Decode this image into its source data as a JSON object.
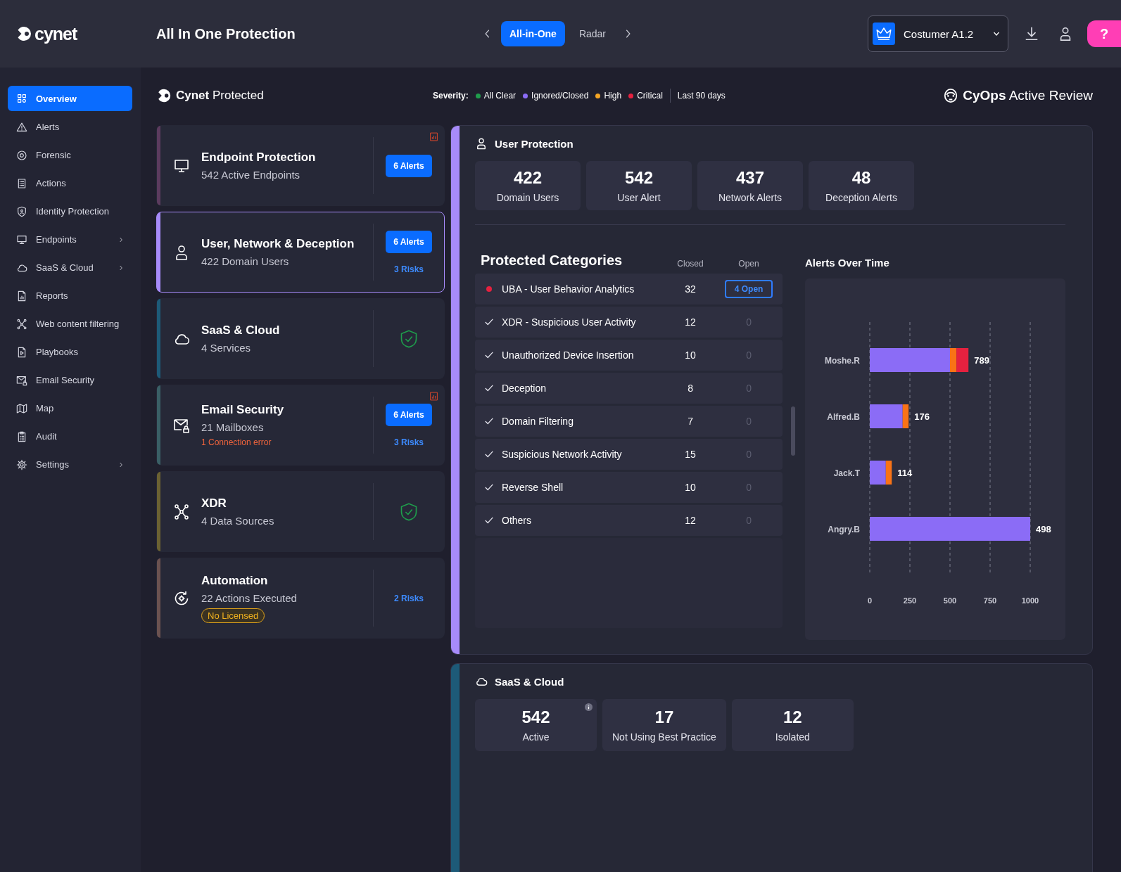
{
  "top_bar": {
    "brand": "cynet",
    "title": "All In One Protection",
    "tabs": [
      {
        "label": "All-in-One",
        "selected": true
      },
      {
        "label": "Radar",
        "selected": false
      }
    ],
    "customer": {
      "value": "Costumer A1.2"
    },
    "help": "?"
  },
  "sidebar": {
    "items": [
      {
        "label": "Overview",
        "selected": true,
        "has_submenu": false
      },
      {
        "label": "Alerts",
        "selected": false,
        "has_submenu": false
      },
      {
        "label": "Forensic",
        "selected": false,
        "has_submenu": false
      },
      {
        "label": "Actions",
        "selected": false,
        "has_submenu": false
      },
      {
        "label": "Identity Protection",
        "selected": false,
        "has_submenu": false
      },
      {
        "label": "Endpoints",
        "selected": false,
        "has_submenu": true
      },
      {
        "label": "SaaS & Cloud",
        "selected": false,
        "has_submenu": true
      },
      {
        "label": "Reports",
        "selected": false,
        "has_submenu": false
      },
      {
        "label": "Web content filtering",
        "selected": false,
        "has_submenu": false
      },
      {
        "label": "Playbooks",
        "selected": false,
        "has_submenu": false
      },
      {
        "label": "Email Security",
        "selected": false,
        "has_submenu": false
      },
      {
        "label": "Map",
        "selected": false,
        "has_submenu": false
      },
      {
        "label": "Audit",
        "selected": false,
        "has_submenu": false
      },
      {
        "label": "Settings",
        "selected": false,
        "has_submenu": true
      }
    ]
  },
  "header": {
    "title": "**Cynet** Protected",
    "severity_label": "Severity:",
    "severity": [
      {
        "label": "All Clear",
        "color": "#1f9d4c"
      },
      {
        "label": "Ignored/Closed",
        "color": "#8b6cf6"
      },
      {
        "label": "High",
        "color": "#f5a524"
      },
      {
        "label": "Critical",
        "color": "#e5213f"
      }
    ],
    "period": "Last 90 days",
    "review": "**CyOps** Active Review"
  },
  "cards": [
    {
      "title": "Endpoint Protection",
      "subtitle": "542 Active Endpoints",
      "alerts": "6 Alerts",
      "chart_icon": true,
      "protected": false,
      "selected": false,
      "color": "#5b3b5e"
    },
    {
      "title": "User, Network & Deception",
      "subtitle": "422 Domain Users",
      "alerts": "6 Alerts",
      "risks": "3 Risks",
      "chart_icon": false,
      "protected": false,
      "selected": true,
      "color": "#a78bfa"
    },
    {
      "title": "SaaS & Cloud",
      "subtitle": "4 Services",
      "chart_icon": false,
      "protected": true,
      "selected": false,
      "color": "#1d5a78"
    },
    {
      "title": "Email Security",
      "subtitle": "21 Mailboxes",
      "error": "1 Connection error",
      "alerts": "6 Alerts",
      "risks": "3 Risks",
      "chart_icon": true,
      "protected": false,
      "selected": false,
      "color": "#3a5f66"
    },
    {
      "title": "XDR",
      "subtitle": "4 Data Sources",
      "chart_icon": false,
      "protected": true,
      "selected": false,
      "color": "#6b6132"
    },
    {
      "title": "Automation",
      "subtitle": "22 Actions Executed",
      "badge": "No Licensed",
      "risks": "2 Risks",
      "chart_icon": false,
      "protected": false,
      "selected": false,
      "color": "#6b5250"
    }
  ],
  "user_protection": {
    "title": "User Protection",
    "color": "#a78bfa",
    "stats": [
      {
        "value": "422",
        "label": "Domain Users"
      },
      {
        "value": "542",
        "label": "User Alert"
      },
      {
        "value": "437",
        "label": "Network Alerts"
      },
      {
        "value": "48",
        "label": "Deception Alerts"
      }
    ],
    "categories": {
      "title": "Protected Categories",
      "columns": [
        "Closed",
        "Open"
      ],
      "rows": [
        {
          "name": "UBA - User Behavior Analytics",
          "critical": true,
          "closed": "32",
          "open": "4 Open",
          "open_active": true
        },
        {
          "name": "XDR - Suspicious User Activity",
          "critical": false,
          "closed": "12",
          "open": "0",
          "open_active": false
        },
        {
          "name": "Unauthorized Device Insertion",
          "critical": false,
          "closed": "10",
          "open": "0",
          "open_active": false
        },
        {
          "name": "Deception",
          "critical": false,
          "closed": "8",
          "open": "0",
          "open_active": false
        },
        {
          "name": "Domain Filtering",
          "critical": false,
          "closed": "7",
          "open": "0",
          "open_active": false
        },
        {
          "name": "Suspicious Network Activity",
          "critical": false,
          "closed": "15",
          "open": "0",
          "open_active": false
        },
        {
          "name": "Reverse Shell",
          "critical": false,
          "closed": "10",
          "open": "0",
          "open_active": false
        },
        {
          "name": "Others",
          "critical": false,
          "closed": "12",
          "open": "0",
          "open_active": false
        }
      ]
    },
    "chart_data": {
      "type": "bar",
      "title": "Alerts Over Time",
      "orientation": "horizontal",
      "stacked": true,
      "grid": true,
      "categories": [
        "Moshe.R",
        "Alfred.B",
        "Jack.T",
        "Angry.B"
      ],
      "series": [
        {
          "color": "#8b6cf6",
          "values": [
            500,
            205,
            100,
            1000
          ]
        },
        {
          "color": "#f97316",
          "values": [
            40,
            37,
            37,
            null
          ]
        },
        {
          "color": "#e5213f",
          "values": [
            75,
            null,
            null,
            null
          ]
        }
      ],
      "xlim": [
        0,
        1000
      ],
      "xticks": [
        0,
        250,
        500,
        750,
        1000
      ],
      "value_labels": [
        "789",
        "176",
        "114",
        "498"
      ]
    }
  },
  "saas_cloud": {
    "title": "SaaS & Cloud",
    "color": "#1d5a78",
    "stats": [
      {
        "value": "542",
        "label": "Active",
        "info": true
      },
      {
        "value": "17",
        "label": "Not Using Best Practice",
        "info": false
      },
      {
        "value": "12",
        "label": "Isolated",
        "info": false
      }
    ]
  }
}
